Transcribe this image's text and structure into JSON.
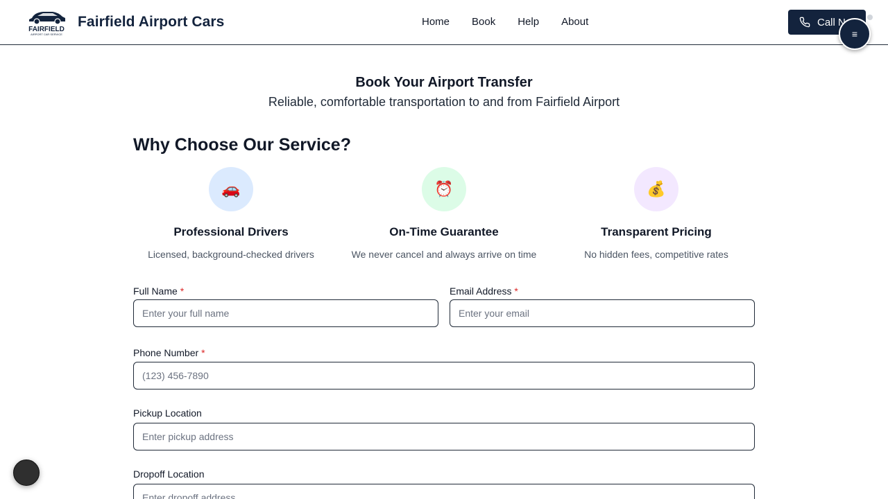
{
  "header": {
    "logo_text": "FAIRFIELD",
    "logo_subtext": "AIRPORT CAR SERVICE",
    "brand": "Fairfield Airport Cars",
    "nav": [
      "Home",
      "Book",
      "Help",
      "About"
    ],
    "call_label": "Call Now",
    "menu_icon": "≡"
  },
  "hero": {
    "title": "Book Your Airport Transfer",
    "subtitle": "Reliable, comfortable transportation to and from Fairfield Airport"
  },
  "why": {
    "title": "Why Choose Our Service?",
    "features": [
      {
        "icon": "🚗",
        "title": "Professional Drivers",
        "desc": "Licensed, background-checked drivers",
        "color": "#dbeafe"
      },
      {
        "icon": "⏰",
        "title": "On-Time Guarantee",
        "desc": "We never cancel and always arrive on time",
        "color": "#dcfce7"
      },
      {
        "icon": "💰",
        "title": "Transparent Pricing",
        "desc": "No hidden fees, competitive rates",
        "color": "#f3e8ff"
      }
    ]
  },
  "form": {
    "full_name": {
      "label": "Full Name",
      "required": "*",
      "placeholder": "Enter your full name"
    },
    "email": {
      "label": "Email Address",
      "required": "*",
      "placeholder": "Enter your email"
    },
    "phone": {
      "label": "Phone Number",
      "required": "*",
      "placeholder": "(123) 456-7890"
    },
    "pickup": {
      "label": "Pickup Location",
      "placeholder": "Enter pickup address"
    },
    "dropoff": {
      "label": "Dropoff Location",
      "placeholder": "Enter dropoff address"
    }
  },
  "colors": {
    "primary": "#13233d",
    "required": "#dc2626"
  }
}
